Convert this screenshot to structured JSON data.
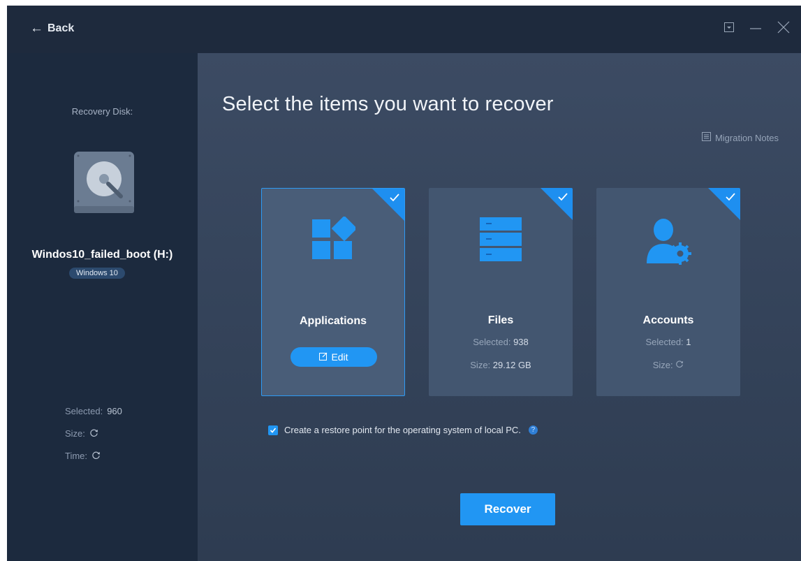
{
  "titlebar": {
    "back_label": "Back",
    "controls": [
      "dropdown-icon",
      "minimize-icon",
      "close-icon"
    ]
  },
  "sidebar": {
    "recovery_disk_label": "Recovery Disk:",
    "disk_name": "Windos10_failed_boot (H:)",
    "os_badge": "Windows 10",
    "stats": {
      "selected_label": "Selected:",
      "selected_value": "960",
      "size_label": "Size:",
      "time_label": "Time:"
    }
  },
  "main": {
    "title": "Select the items you want to recover",
    "notes_label": "Migration Notes",
    "cards": [
      {
        "title": "Applications",
        "icon": "applications-icon",
        "checked": true,
        "edit_label": "Edit"
      },
      {
        "title": "Files",
        "icon": "files-icon",
        "checked": true,
        "selected_label": "Selected:",
        "selected_value": "938",
        "size_label": "Size:",
        "size_value": "29.12 GB"
      },
      {
        "title": "Accounts",
        "icon": "accounts-icon",
        "checked": true,
        "selected_label": "Selected:",
        "selected_value": "1",
        "size_label": "Size:"
      }
    ],
    "restore_point": {
      "checked": true,
      "label": "Create a restore point for the operating system of local PC.",
      "help_glyph": "?"
    },
    "recover_button": "Recover"
  },
  "colors": {
    "accent": "#2196f3",
    "sidebar_bg": "#1c2a3e",
    "main_bg": "#3c4b63",
    "card_bg": "#435670"
  }
}
